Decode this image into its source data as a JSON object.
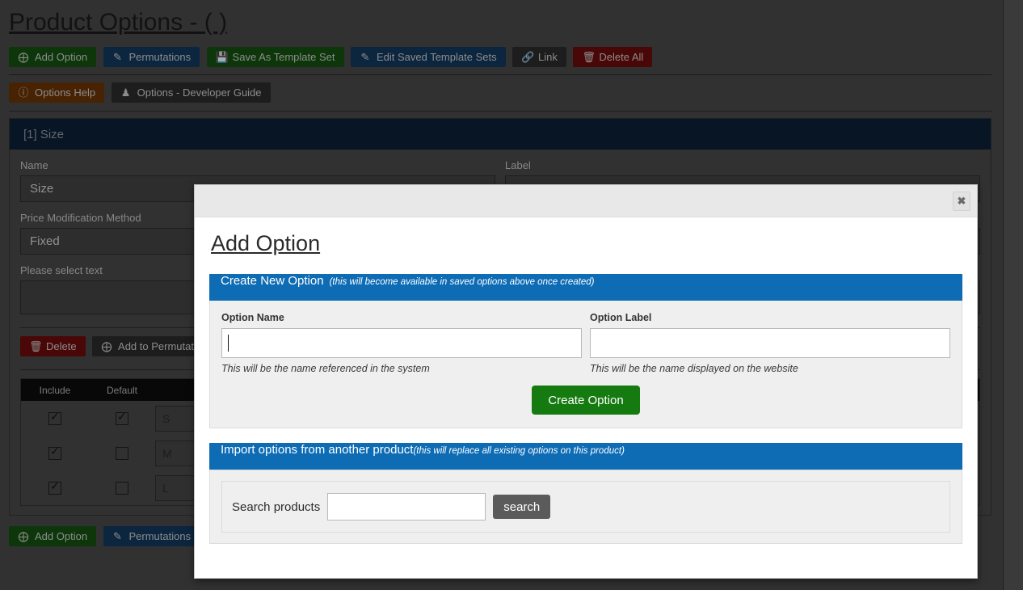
{
  "page": {
    "title": "Product Options - ( )",
    "toolbar_primary": [
      {
        "label": "Add Option",
        "icon": "plus-circle-icon",
        "glyph": "⊕",
        "style": "green"
      },
      {
        "label": "Permutations",
        "icon": "pencil-icon",
        "glyph": "✎",
        "style": "blue"
      },
      {
        "label": "Save As Template Set",
        "icon": "save-disk-icon",
        "glyph": "▣",
        "style": "green"
      },
      {
        "label": "Edit Saved Template Sets",
        "icon": "pencil-icon",
        "glyph": "✎",
        "style": "blue"
      },
      {
        "label": "Link",
        "icon": "link-icon",
        "glyph": "⚭",
        "style": "dark"
      },
      {
        "label": "Delete All",
        "icon": "trash-icon",
        "glyph": "Ὕ1",
        "style": "red"
      }
    ],
    "toolbar_secondary": [
      {
        "label": "Options Help",
        "icon": "question-circle-icon",
        "glyph": "?",
        "style": "orange"
      },
      {
        "label": "Options - Developer Guide",
        "icon": "robot-icon",
        "glyph": "♟",
        "style": "dark"
      }
    ],
    "option_panel": {
      "heading": "[1] Size",
      "name_label": "Name",
      "name_value": "Size",
      "label_label": "Label",
      "label_value": "",
      "price_method_label": "Price Modification Method",
      "price_method_value": "Fixed",
      "select_text_label": "Please select text",
      "select_text_value": "",
      "delete_label": "Delete",
      "delete_icon": "trash-icon",
      "add_to_permutations_label": "Add to Permutations",
      "add_to_permutations_icon": "plus-circle-icon",
      "table": {
        "columns": [
          "Include",
          "Default",
          ""
        ],
        "rows": [
          {
            "include": true,
            "default": true,
            "value": "S"
          },
          {
            "include": true,
            "default": false,
            "value": "M"
          },
          {
            "include": true,
            "default": false,
            "value": "L"
          }
        ]
      }
    },
    "toolbar_bottom": [
      {
        "label": "Add Option",
        "icon": "plus-circle-icon",
        "glyph": "⊕",
        "style": "green"
      },
      {
        "label": "Permutations",
        "icon": "pencil-icon",
        "glyph": "✎",
        "style": "blue"
      }
    ]
  },
  "modal": {
    "close_icon": "close-icon",
    "close_glyph": "✖",
    "title": "Add Option",
    "create_section": {
      "heading": "Create New Option",
      "heading_note": "(this will become available in saved options above once created)",
      "option_name_label": "Option Name",
      "option_name_value": "",
      "option_name_hint": "This will be the name referenced in the system",
      "option_label_label": "Option Label",
      "option_label_value": "",
      "option_label_hint": "This will be the name displayed on the website",
      "create_button": "Create Option"
    },
    "import_section": {
      "heading": "Import options from another product",
      "heading_note": "(this will replace all existing options on this product)",
      "search_label": "Search products",
      "search_value": "",
      "search_button": "search"
    }
  },
  "colors": {
    "accent_blue": "#0e6cb5",
    "panel_header_navy": "#0d2036",
    "green_button": "#157a10",
    "danger_red": "#6d0b0b",
    "page_background": "#4a4a4a",
    "modal_background": "#ffffff"
  }
}
